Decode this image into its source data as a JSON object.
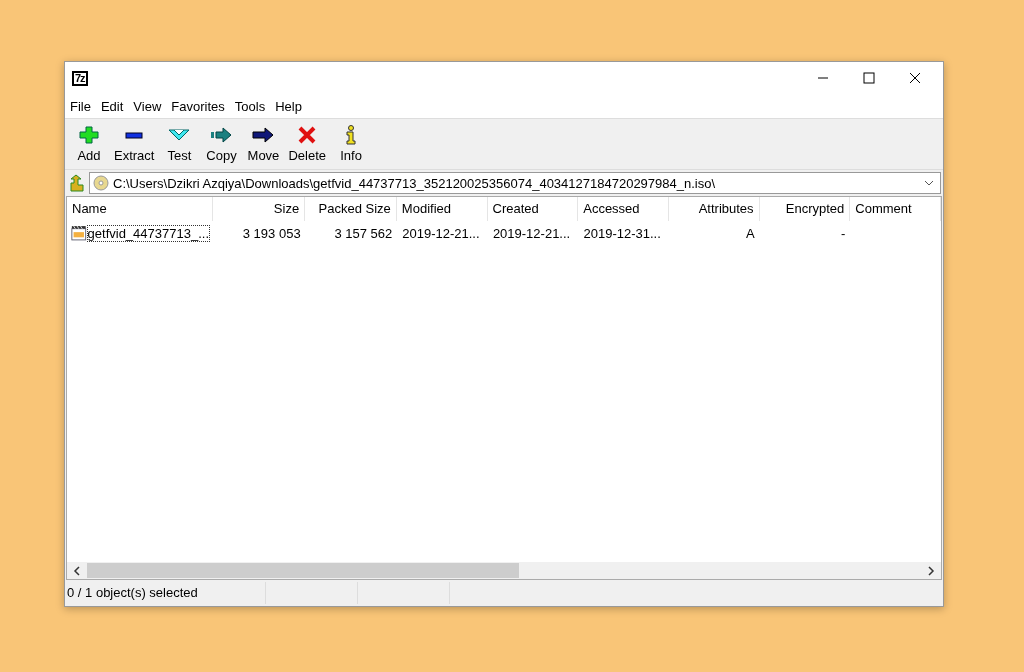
{
  "window": {
    "title_icon": "7z"
  },
  "menu": [
    "File",
    "Edit",
    "View",
    "Favorites",
    "Tools",
    "Help"
  ],
  "toolbar": [
    {
      "label": "Add",
      "kind": "add"
    },
    {
      "label": "Extract",
      "kind": "extract"
    },
    {
      "label": "Test",
      "kind": "test"
    },
    {
      "label": "Copy",
      "kind": "copy"
    },
    {
      "label": "Move",
      "kind": "move"
    },
    {
      "label": "Delete",
      "kind": "delete"
    },
    {
      "label": "Info",
      "kind": "info"
    }
  ],
  "address": {
    "value": "C:\\Users\\Dzikri Azqiya\\Downloads\\getfvid_44737713_352120025356074_4034127184720297984_n.iso\\"
  },
  "table": {
    "columns": [
      "Name",
      "Size",
      "Packed Size",
      "Modified",
      "Created",
      "Accessed",
      "Attributes",
      "Encrypted",
      "Comment"
    ],
    "rows": [
      {
        "focused": true,
        "cells": [
          "getfvid_44737713_...",
          "3 193 053",
          "3 157 562",
          "2019-12-21...",
          "2019-12-21...",
          "2019-12-31...",
          "A",
          "-",
          ""
        ]
      }
    ]
  },
  "status_bar": [
    "0 / 1 object(s) selected"
  ]
}
